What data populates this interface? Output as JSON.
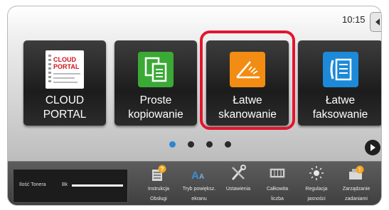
{
  "status": {
    "time": "10:15"
  },
  "home": {
    "tiles": [
      {
        "label": "CLOUD PORTAL",
        "icon": "cloud-portal-icon",
        "logo_text": "CLOUD PORTAL"
      },
      {
        "label_line1": "Proste",
        "label_line2": "kopiowanie",
        "icon": "copy-icon",
        "color": "#3aa935"
      },
      {
        "label_line1": "Łatwe",
        "label_line2": "skanowanie",
        "icon": "scan-icon",
        "color": "#f28c12",
        "selected": true
      },
      {
        "label_line1": "Łatwe",
        "label_line2": "faksowanie",
        "icon": "fax-icon",
        "color": "#1c8ad8"
      }
    ],
    "pager": {
      "pages": 4,
      "current": 1
    }
  },
  "bottom_bar": {
    "toner_label": "Ilość Tonera",
    "toner_color": "Bk",
    "functions": [
      {
        "line1": "Instrukcja",
        "line2": "Obsługi",
        "icon": "manual-icon"
      },
      {
        "line1": "Tryb powiększ.",
        "line2": "ekranu",
        "icon": "zoom-mode-icon"
      },
      {
        "line1": "Ustawienia",
        "line2": "",
        "icon": "settings-icon"
      },
      {
        "line1": "Całkowita",
        "line2": "liczba",
        "icon": "counter-icon"
      },
      {
        "line1": "Regulacja",
        "line2": "jasności",
        "icon": "brightness-icon"
      },
      {
        "line1": "Zarządzanie",
        "line2": "zadaniami",
        "icon": "job-status-icon"
      }
    ]
  },
  "colors": {
    "selection": "#e3142e",
    "pager_active": "#2b86d6"
  }
}
